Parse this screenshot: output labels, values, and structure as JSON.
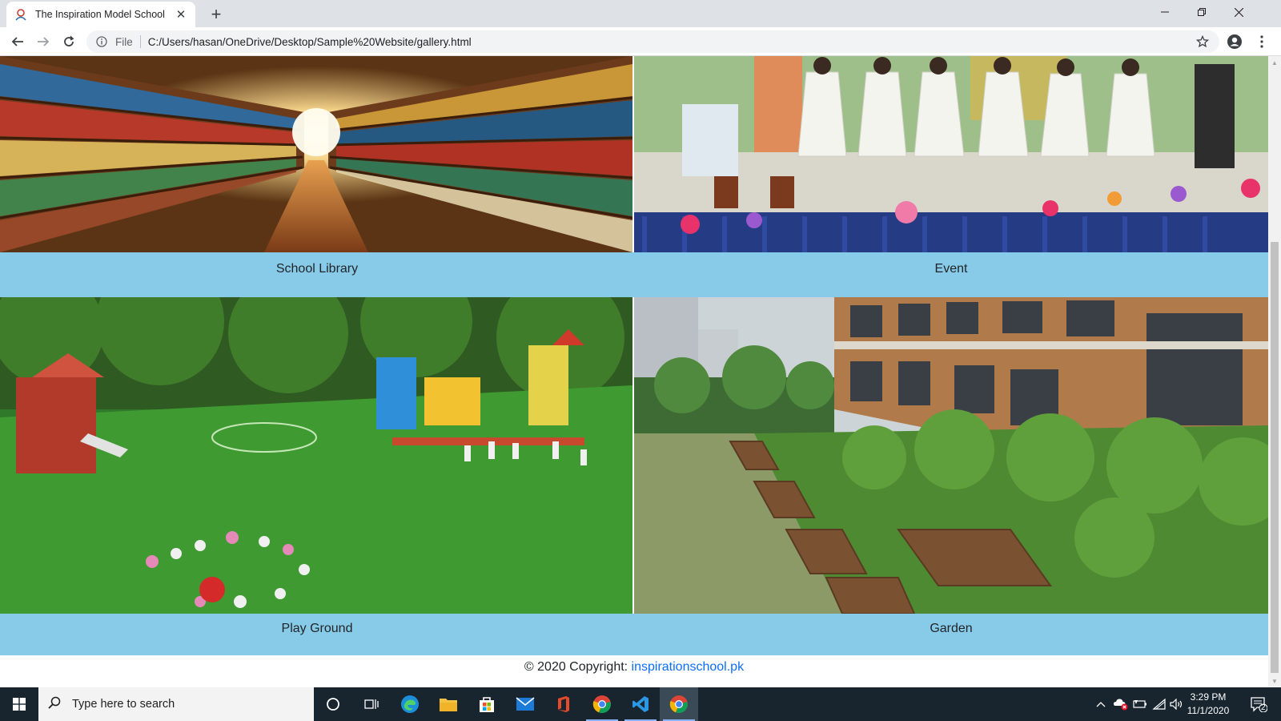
{
  "browser": {
    "tab_title": "The Inspiration Model School",
    "new_tab_label": "+",
    "omnibox": {
      "scheme_label": "File",
      "url": "C:/Users/hasan/OneDrive/Desktop/Sample%20Website/gallery.html"
    },
    "icons": {
      "back": "back-arrow-icon",
      "forward": "forward-arrow-icon",
      "reload": "reload-icon",
      "info": "info-icon",
      "bookmark": "star-icon",
      "profile": "profile-icon",
      "menu": "menu-dots-icon",
      "minimize": "minimize-icon",
      "restore": "restore-icon",
      "close": "close-icon"
    }
  },
  "gallery": {
    "items": [
      {
        "caption": "School Library",
        "image": "library bookshelves corridor"
      },
      {
        "caption": "Event",
        "image": "children stage performance"
      },
      {
        "caption": "Play Ground",
        "image": "playground with children on grass"
      },
      {
        "caption": "Garden",
        "image": "school garden beds beside building"
      }
    ]
  },
  "footer": {
    "copyright_prefix": "© 2020 Copyright: ",
    "link_text": "inspirationschool.pk"
  },
  "taskbar": {
    "search_placeholder": "Type here to search",
    "time": "3:29 PM",
    "date": "11/1/2020",
    "notification_count": "2"
  },
  "colors": {
    "caption_bar": "#87cbe8",
    "link": "#0d6efd",
    "taskbar": "#18252f",
    "tabbar": "#dee1e6"
  }
}
